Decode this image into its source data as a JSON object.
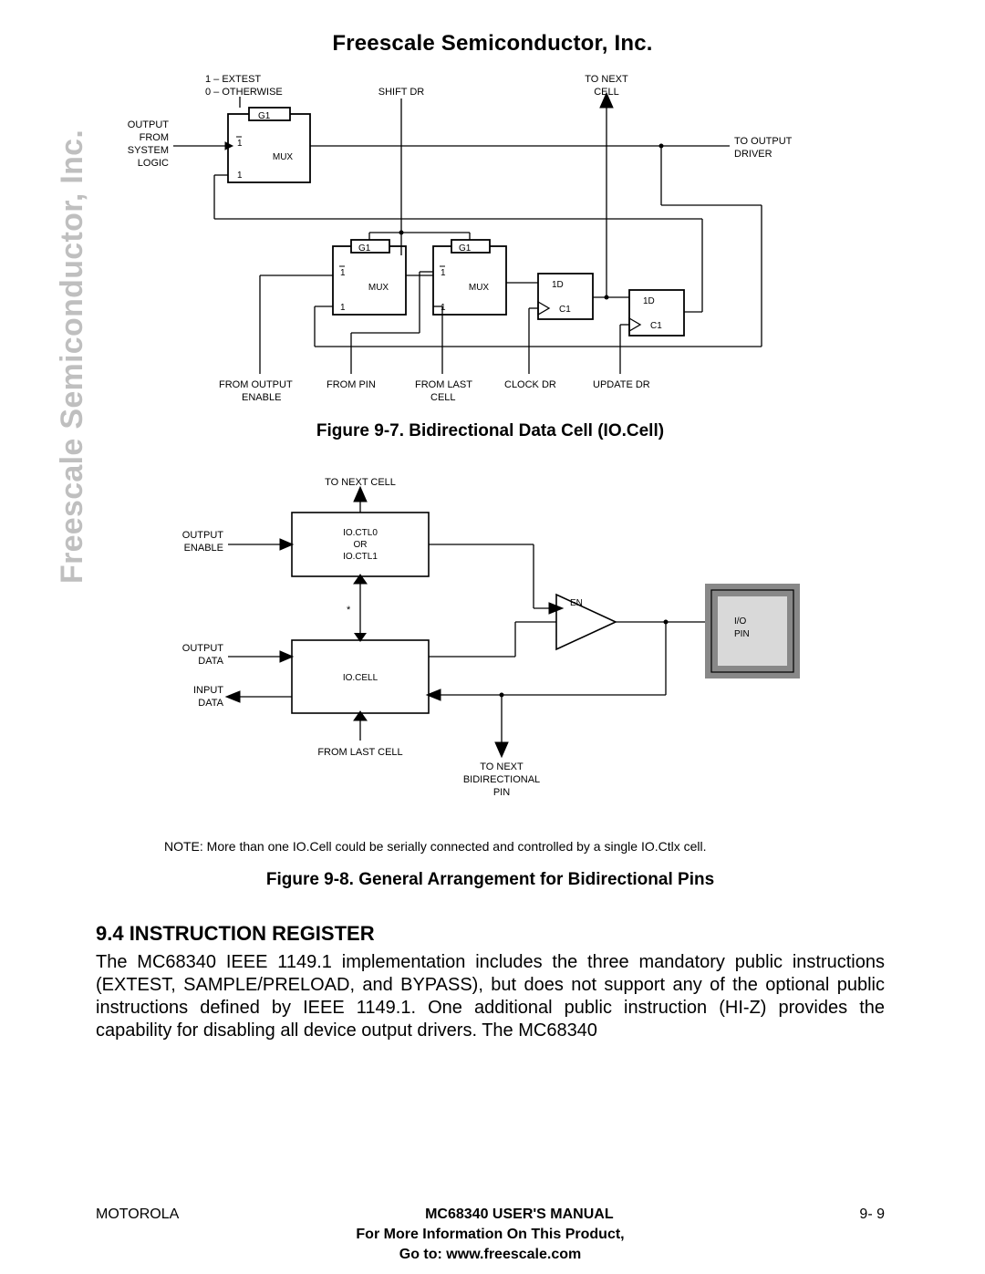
{
  "header": {
    "title": "Freescale Semiconductor, Inc."
  },
  "watermark": "Freescale Semiconductor, Inc.",
  "diagram1": {
    "extest_label_line1": "1 – EXTEST",
    "extest_label_line2": "0 – OTHERWISE",
    "shiftdr": "SHIFT DR",
    "tonext": "TO NEXT",
    "tonext2": "CELL",
    "output_from_system_logic_1": "OUTPUT",
    "output_from_system_logic_2": "FROM",
    "output_from_system_logic_3": "SYSTEM",
    "output_from_system_logic_4": "LOGIC",
    "g1": "G1",
    "one": "1",
    "one_bar": "1",
    "mux": "MUX",
    "to_output_1": "TO OUTPUT",
    "to_output_2": "DRIVER",
    "oneD": "1D",
    "c1": "C1",
    "from_output_enable_1": "FROM OUTPUT",
    "from_output_enable_2": "ENABLE",
    "from_pin": "FROM  PIN",
    "from_last_cell_1": "FROM LAST",
    "from_last_cell_2": "CELL",
    "clockdr": "CLOCK DR",
    "updatedr": "UPDATE DR",
    "caption": "Figure 9-7. Bidirectional Data Cell (IO.Cell)"
  },
  "diagram2": {
    "to_next_cell": "TO NEXT CELL",
    "output_enable_1": "OUTPUT",
    "output_enable_2": "ENABLE",
    "ioctl_1": "IO.CTL0",
    "ioctl_2": "OR",
    "ioctl_3": "IO.CTL1",
    "star": "*",
    "en": "EN",
    "io_pin_1": "I/O",
    "io_pin_2": "PIN",
    "output_data_1": "OUTPUT",
    "output_data_2": "DATA",
    "iocell": "IO.CELL",
    "input_data_1": "INPUT",
    "input_data_2": "DATA",
    "from_last_cell": "FROM LAST CELL",
    "to_next_bidir_1": "TO NEXT",
    "to_next_bidir_2": "BIDIRECTIONAL",
    "to_next_bidir_3": "PIN",
    "note": "NOTE:  More than one IO.Cell could be serially connected and controlled by a single IO.Ctlx cell.",
    "caption": "Figure 9-8. General Arrangement for Bidirectional Pins"
  },
  "section": {
    "heading": "9.4 INSTRUCTION REGISTER",
    "body": "The MC68340 IEEE 1149.1 implementation includes the three mandatory public instructions (EXTEST, SAMPLE/PRELOAD, and BYPASS), but does not support any of the optional public instructions defined by IEEE 1149.1. One additional public instruction (HI-Z) provides the capability for disabling all device output drivers. The MC68340"
  },
  "footer": {
    "left": "MOTOROLA",
    "center": "MC68340 USER'S MANUAL",
    "right": "9- 9",
    "line2": "For More Information On This Product,",
    "line3": "Go to: www.freescale.com"
  }
}
